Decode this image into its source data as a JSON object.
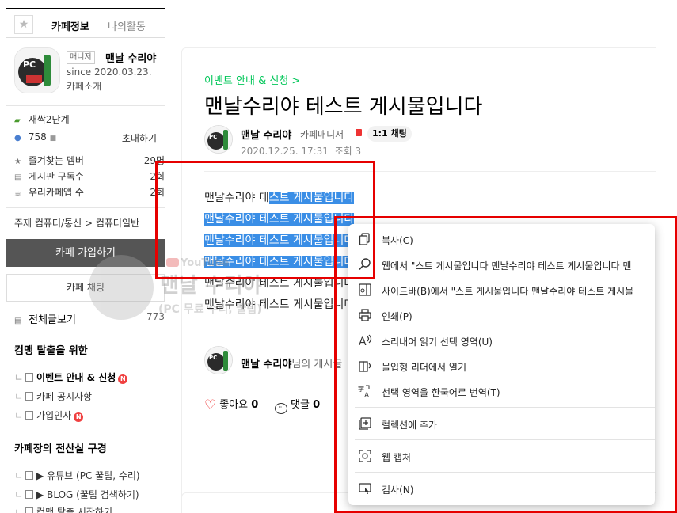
{
  "sidebar": {
    "tabs": {
      "star": "★",
      "cafe_info": "카페정보",
      "my_activity": "나의활동"
    },
    "profile": {
      "manager_badge": "매니저",
      "manager_name": "맨날 수리야",
      "since": "since 2020.03.23.",
      "intro": "카페소개"
    },
    "stats": {
      "level": "새싹2단계",
      "members": "758",
      "invite": "초대하기",
      "fav_members_label": "즐겨찾는 멤버",
      "fav_members_value": "29명",
      "board_subs_label": "게시판 구독수",
      "board_subs_value": "2회",
      "app_users_label": "우리카페앱 수",
      "app_users_value": "2회"
    },
    "topic": "주제  컴퓨터/통신 > 컴퓨터일반",
    "join_button": "카페 가입하기",
    "chat_button": "카페 채팅",
    "all_posts_label": "전체글보기",
    "all_posts_count": "773",
    "section1_title": "컴맹 탈출을 위한",
    "section1_items": [
      "이벤트 안내 & 신청",
      "카페 공지사항",
      "가입인사"
    ],
    "section2_title": "카페장의 전산실 구경",
    "section2_items": [
      "▶ 유튜브 (PC 꿀팁, 수리)",
      "▶ BLOG (꿀팁 검색하기)",
      "컴맹 탈출 시작하기"
    ]
  },
  "post": {
    "category": "이벤트 안내 & 신청 >",
    "title": "맨날수리야 테스트 게시물입니다",
    "author": "맨날 수리야",
    "role": "카페매니저",
    "chat_chip": "1:1 채팅",
    "date": "2020.12.25. 17:31",
    "views": "조회 3",
    "line1_plain": "맨날수리야 테",
    "line1_hl": "스트 게시물입니다",
    "line_hl": "맨날수리야 테스트 게시물입니다",
    "line_plain": "맨날수리야 테스트 게시물입니다",
    "footer_name": "맨날 수리야",
    "footer_suffix": "님의 게시글",
    "like_label": "좋아요",
    "like_count": "0",
    "comment_label": "댓글",
    "comment_count": "0"
  },
  "watermark": {
    "youtube": "YouTube",
    "name": "맨날 수리야",
    "sub": "(PC 무료 수리, 꿀팁)"
  },
  "context_menu": {
    "items": [
      {
        "icon": "copy-icon",
        "label": "복사(C)"
      },
      {
        "icon": "search-web-icon",
        "label": "웹에서 \"스트 게시물입니다  맨날수리야 테스트 게시물입니다  맨"
      },
      {
        "icon": "sidebar-icon",
        "label": "사이드바(B)에서 \"스트 게시물입니다  맨날수리야 테스트 게시물"
      },
      {
        "icon": "print-icon",
        "label": "인쇄(P)"
      },
      {
        "icon": "read-aloud-icon",
        "label": "소리내어 읽기 선택 영역(U)"
      },
      {
        "icon": "immersive-reader-icon",
        "label": "몰입형 리더에서 열기"
      },
      {
        "icon": "translate-icon",
        "label": "선택 영역을 한국어로 번역(T)"
      },
      {
        "icon": "collections-icon",
        "label": "컬렉션에 추가"
      },
      {
        "icon": "web-capture-icon",
        "label": "웹 캡처"
      },
      {
        "icon": "inspect-icon",
        "label": "검사(N)"
      }
    ]
  },
  "colors": {
    "accent_green": "#03c75a",
    "selection_blue": "#3a8ee6",
    "annotation_red": "#e60000",
    "join_button_bg": "#555555"
  }
}
